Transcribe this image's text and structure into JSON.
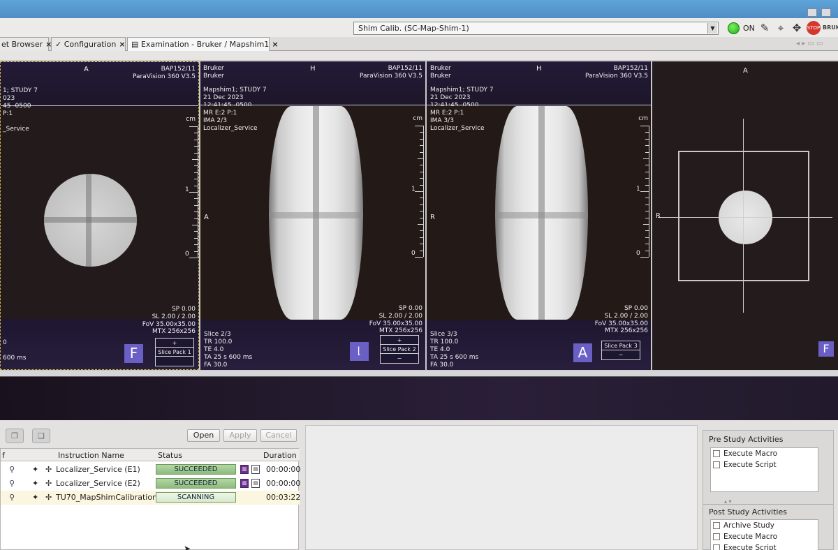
{
  "toolbar": {
    "mode_value": "Shim Calib. (SC-Map-Shim-1)",
    "status_text": "ON",
    "brand_fragment": "BRUK"
  },
  "tabs": [
    {
      "label": "et Browser"
    },
    {
      "label": "Configuration"
    },
    {
      "label": "Examination - Bruker / Mapshim1"
    }
  ],
  "viewports": [
    {
      "orient_top": "A",
      "orient_left": "",
      "hdr_right_1": "BAP152/11",
      "hdr_right_2": "ParaVision 360 V3.5",
      "info_lines": [
        "1; STUDY 7",
        "023",
        "45 -0500",
        "P:1",
        "",
        "_Service"
      ],
      "scale_unit": "cm",
      "scale_1": "1",
      "scale_0": "0",
      "sp": "SP 0.00",
      "sl": "SL 2.00 / 2.00",
      "fov": "FoV 35.00x35.00",
      "mtx": "MTX 256x256",
      "bottom_lines": [
        "",
        "0",
        "",
        "600 ms"
      ],
      "corner_letter": "F",
      "slice_pack": "Slice Pack 1"
    },
    {
      "orient_top": "H",
      "orient_left": "A",
      "hdr_left_1": "Bruker",
      "hdr_left_2": "Bruker",
      "hdr_right_1": "BAP152/11",
      "hdr_right_2": "ParaVision 360 V3.5",
      "info_lines": [
        "Mapshim1; STUDY 7",
        "21 Dec 2023",
        "12:41:45 -0500",
        "MR E:2 P:1",
        "IMA 2/3",
        "Localizer_Service"
      ],
      "scale_unit": "cm",
      "scale_1": "1",
      "scale_0": "0",
      "sp": "SP 0.00",
      "sl": "SL 2.00 / 2.00",
      "fov": "FoV 35.00x35.00",
      "mtx": "MTX 256x256",
      "bottom_lines": [
        "Slice 2/3",
        "TR 100.0",
        "TE 4.0",
        "TA 25 s 600 ms",
        "FA 30.0"
      ],
      "corner_letter": "",
      "slice_pack": "Slice Pack 2"
    },
    {
      "orient_top": "H",
      "orient_left": "R",
      "hdr_left_1": "Bruker",
      "hdr_left_2": "Bruker",
      "hdr_right_1": "BAP152/11",
      "hdr_right_2": "ParaVision 360 V3.5",
      "info_lines": [
        "Mapshim1; STUDY 7",
        "21 Dec 2023",
        "12:41:45 -0500",
        "MR E:2 P:1",
        "IMA 3/3",
        "Localizer_Service"
      ],
      "scale_unit": "cm",
      "scale_1": "1",
      "scale_0": "0",
      "sp": "SP 0.00",
      "sl": "SL 2.00 / 2.00",
      "fov": "FoV 35.00x35.00",
      "mtx": "MTX 256x256",
      "bottom_lines": [
        "Slice 3/3",
        "TR 100.0",
        "TE 4.0",
        "TA 25 s 600 ms",
        "FA 30.0"
      ],
      "corner_letter": "A",
      "slice_pack": "Slice Pack 3"
    },
    {
      "orient_top": "A",
      "orient_left": "R",
      "corner_letter": "F"
    }
  ],
  "slice_controls": {
    "plus": "+",
    "minus": "−"
  },
  "actions": {
    "open": "Open",
    "apply": "Apply",
    "cancel": "Cancel"
  },
  "instruction_list": {
    "headers": {
      "col0": "f",
      "name": "Instruction Name",
      "status": "Status",
      "duration": "Duration"
    },
    "rows": [
      {
        "name": "Localizer_Service (E1)",
        "status": "SUCCEEDED",
        "duration": "00:00:00"
      },
      {
        "name": "Localizer_Service (E2)",
        "status": "SUCCEEDED",
        "duration": "00:00:00"
      },
      {
        "name": "TU70_MapShimCalibration (",
        "status": "SCANNING",
        "duration": "00:03:22"
      }
    ]
  },
  "pre_study": {
    "title": "Pre Study Activities",
    "items": [
      {
        "label": "Execute Macro"
      },
      {
        "label": "Execute Script"
      }
    ]
  },
  "post_study": {
    "title": "Post Study Activities",
    "items": [
      {
        "label": "Archive Study"
      },
      {
        "label": "Execute Macro"
      },
      {
        "label": "Execute Script"
      }
    ]
  },
  "colors": {
    "accent_purple": "#6a5fc4",
    "status_green": "#8dbb7c",
    "led_green": "#1fae1a"
  }
}
